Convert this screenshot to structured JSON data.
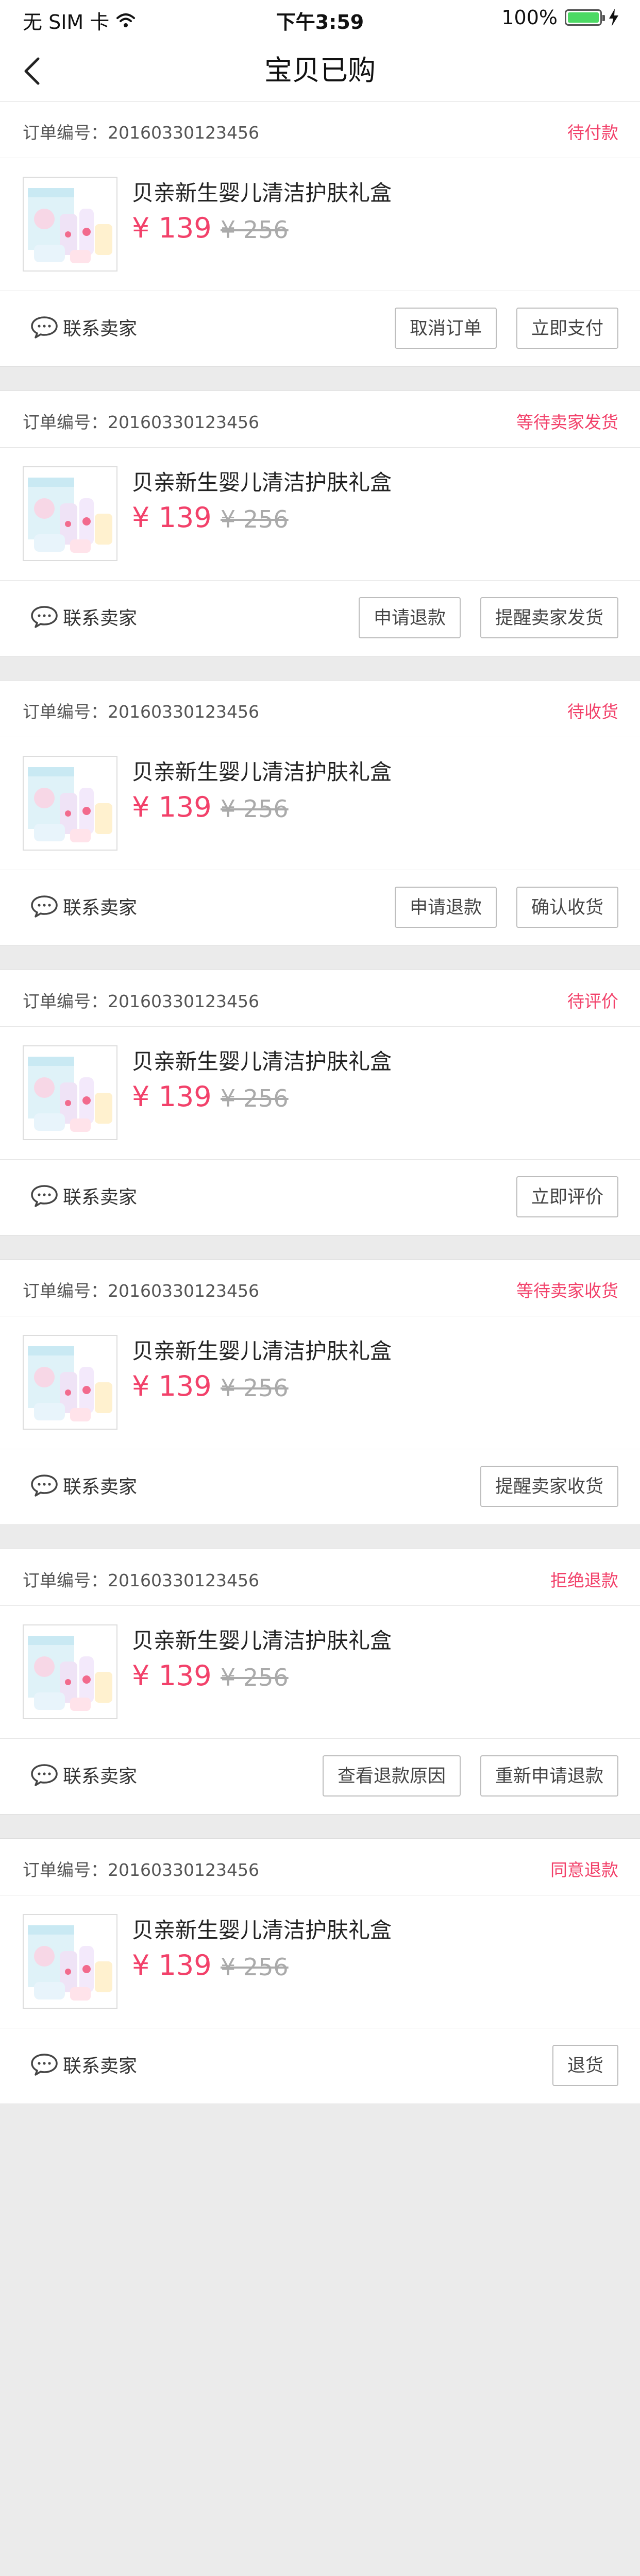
{
  "status_bar": {
    "carrier": "无 SIM 卡",
    "time": "下午3:59",
    "battery_percent": "100%",
    "battery_color": "#4cd964",
    "wifi_icon": "wifi-icon",
    "charging_icon": "lightning-icon"
  },
  "nav": {
    "title": "宝贝已购",
    "back_icon": "chevron-left-icon"
  },
  "colors": {
    "accent": "#f2416a",
    "background": "#ebebeb"
  },
  "orders": [
    {
      "order_no": "订单编号：20160330123456",
      "status": "待付款",
      "product_name": "贝亲新生婴儿清洁护肤礼盒",
      "price": "¥ 139",
      "original_price": "¥ 256",
      "contact_label": "联系卖家",
      "buttons": [
        "取消订单",
        "立即支付"
      ]
    },
    {
      "order_no": "订单编号：20160330123456",
      "status": "等待卖家发货",
      "product_name": "贝亲新生婴儿清洁护肤礼盒",
      "price": "¥ 139",
      "original_price": "¥ 256",
      "contact_label": "联系卖家",
      "buttons": [
        "申请退款",
        "提醒卖家发货"
      ]
    },
    {
      "order_no": "订单编号：20160330123456",
      "status": "待收货",
      "product_name": "贝亲新生婴儿清洁护肤礼盒",
      "price": "¥ 139",
      "original_price": "¥ 256",
      "contact_label": "联系卖家",
      "buttons": [
        "申请退款",
        "确认收货"
      ]
    },
    {
      "order_no": "订单编号：20160330123456",
      "status": "待评价",
      "product_name": "贝亲新生婴儿清洁护肤礼盒",
      "price": "¥ 139",
      "original_price": "¥ 256",
      "contact_label": "联系卖家",
      "buttons": [
        "立即评价"
      ]
    },
    {
      "order_no": "订单编号：20160330123456",
      "status": "等待卖家收货",
      "product_name": "贝亲新生婴儿清洁护肤礼盒",
      "price": "¥ 139",
      "original_price": "¥ 256",
      "contact_label": "联系卖家",
      "buttons": [
        "提醒卖家收货"
      ]
    },
    {
      "order_no": "订单编号：20160330123456",
      "status": "拒绝退款",
      "product_name": "贝亲新生婴儿清洁护肤礼盒",
      "price": "¥ 139",
      "original_price": "¥ 256",
      "contact_label": "联系卖家",
      "buttons": [
        "查看退款原因",
        "重新申请退款"
      ]
    },
    {
      "order_no": "订单编号：20160330123456",
      "status": "同意退款",
      "product_name": "贝亲新生婴儿清洁护肤礼盒",
      "price": "¥ 139",
      "original_price": "¥ 256",
      "contact_label": "联系卖家",
      "buttons": [
        "退货"
      ]
    }
  ]
}
